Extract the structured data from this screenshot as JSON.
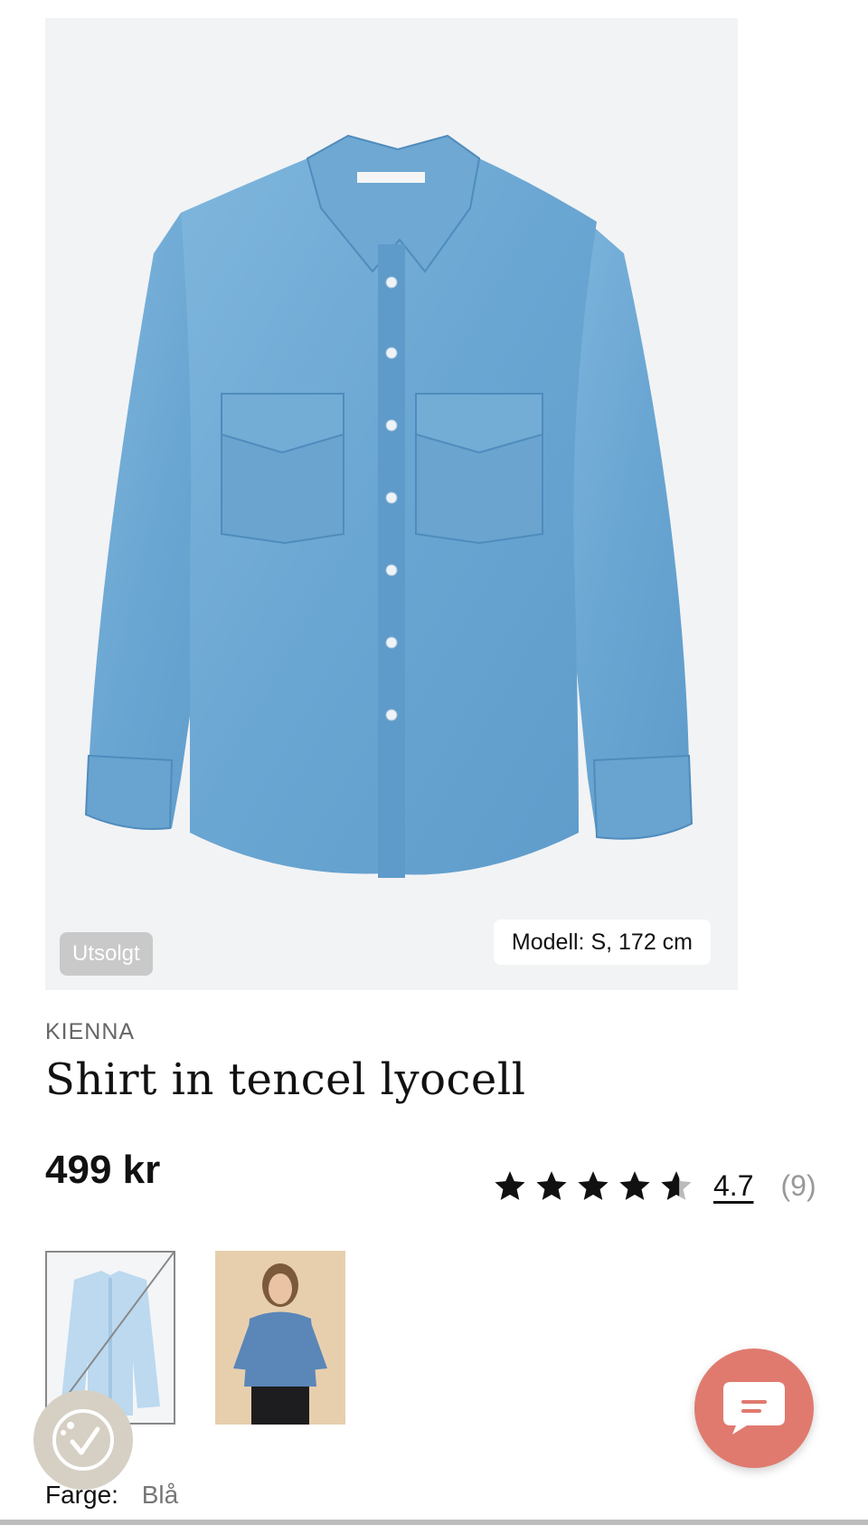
{
  "product": {
    "brand": "KIENNA",
    "title": "Shirt in tencel lyocell",
    "price": "499 kr",
    "rating_value": "4.7",
    "rating_count": "(9)",
    "rating_stars": 4.7,
    "rating_max": 5
  },
  "image": {
    "soldout_badge": "Utsolgt",
    "model_info": "Modell: S, 172 cm"
  },
  "color": {
    "label": "Farge:",
    "value": "Blå"
  },
  "icons": {
    "star": "star-icon",
    "chat": "chat-icon",
    "eco": "eco-badge-icon"
  },
  "colors": {
    "shirt_blue": "#6fa9d4",
    "chat_accent": "#e07a6e",
    "badge_grey": "#c9c9c9"
  }
}
